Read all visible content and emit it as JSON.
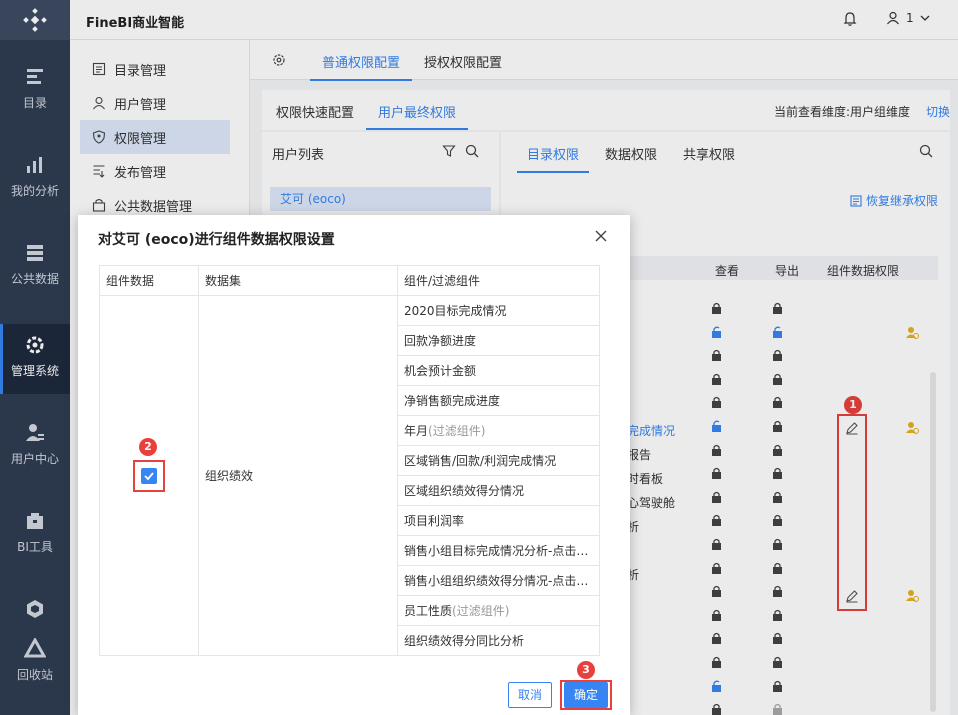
{
  "app": {
    "title": "FineBI商业智能",
    "user": "1"
  },
  "leftnav": [
    {
      "label": "目录",
      "icon": "catalog-icon"
    },
    {
      "label": "我的分析",
      "icon": "analysis-icon"
    },
    {
      "label": "公共数据",
      "icon": "database-icon"
    },
    {
      "label": "管理系统",
      "icon": "gear-icon",
      "active": true
    },
    {
      "label": "用户中心",
      "icon": "user-center-icon"
    },
    {
      "label": "BI工具",
      "icon": "toolbox-icon"
    },
    {
      "label": "",
      "icon": "cube-icon"
    },
    {
      "label": "回收站",
      "icon": "recycle-icon"
    }
  ],
  "sidemenu": {
    "items": [
      {
        "label": "目录管理",
        "icon": "list-icon"
      },
      {
        "label": "用户管理",
        "icon": "user-icon"
      },
      {
        "label": "权限管理",
        "icon": "shield-icon",
        "active": true
      },
      {
        "label": "发布管理",
        "icon": "publish-icon"
      },
      {
        "label": "公共数据管理",
        "icon": "lock-box-icon"
      }
    ]
  },
  "tabs": {
    "normal": "普通权限配置",
    "grant": "授权权限配置"
  },
  "subtabs": {
    "quick": "权限快速配置",
    "final": "用户最终权限"
  },
  "dimension": {
    "text": "当前查看维度:用户组维度",
    "switch": "切换"
  },
  "userlist": {
    "header": "用户列表",
    "selected": "艾可 (eoco)"
  },
  "perm": {
    "tabs": [
      "目录权限",
      "数据权限",
      "共享权限"
    ],
    "restore": "恢复继承权限",
    "cols": {
      "view": "查看",
      "export": "导出",
      "comp": "组件数据权限"
    },
    "rows": [
      "完成情况",
      "报告",
      "时看板",
      "心驾驶舱",
      "析",
      "析"
    ]
  },
  "badges": {
    "one": "1",
    "two": "2",
    "three": "3"
  },
  "dialog": {
    "title": "对艾可 (eoco)进行组件数据权限设置",
    "headers": {
      "data": "组件数据",
      "dataset": "数据集",
      "component": "组件/过滤组件"
    },
    "dataset": "组织绩效",
    "components": [
      {
        "name": "2020目标完成情况",
        "suffix": ""
      },
      {
        "name": "回款净额进度",
        "suffix": ""
      },
      {
        "name": "机会预计金额",
        "suffix": ""
      },
      {
        "name": "净销售额完成进度",
        "suffix": ""
      },
      {
        "name": "年月",
        "suffix": "(过滤组件)"
      },
      {
        "name": "区域销售/回款/利润完成情况",
        "suffix": ""
      },
      {
        "name": "区域组织绩效得分情况",
        "suffix": ""
      },
      {
        "name": "项目利润率",
        "suffix": ""
      },
      {
        "name": "销售小组目标完成情况分析-点击…",
        "suffix": ""
      },
      {
        "name": "销售小组组织绩效得分情况-点击…",
        "suffix": ""
      },
      {
        "name": "员工性质",
        "suffix": "(过滤组件)"
      },
      {
        "name": "组织绩效得分同比分析",
        "suffix": ""
      }
    ],
    "cancel": "取消",
    "ok": "确定"
  }
}
